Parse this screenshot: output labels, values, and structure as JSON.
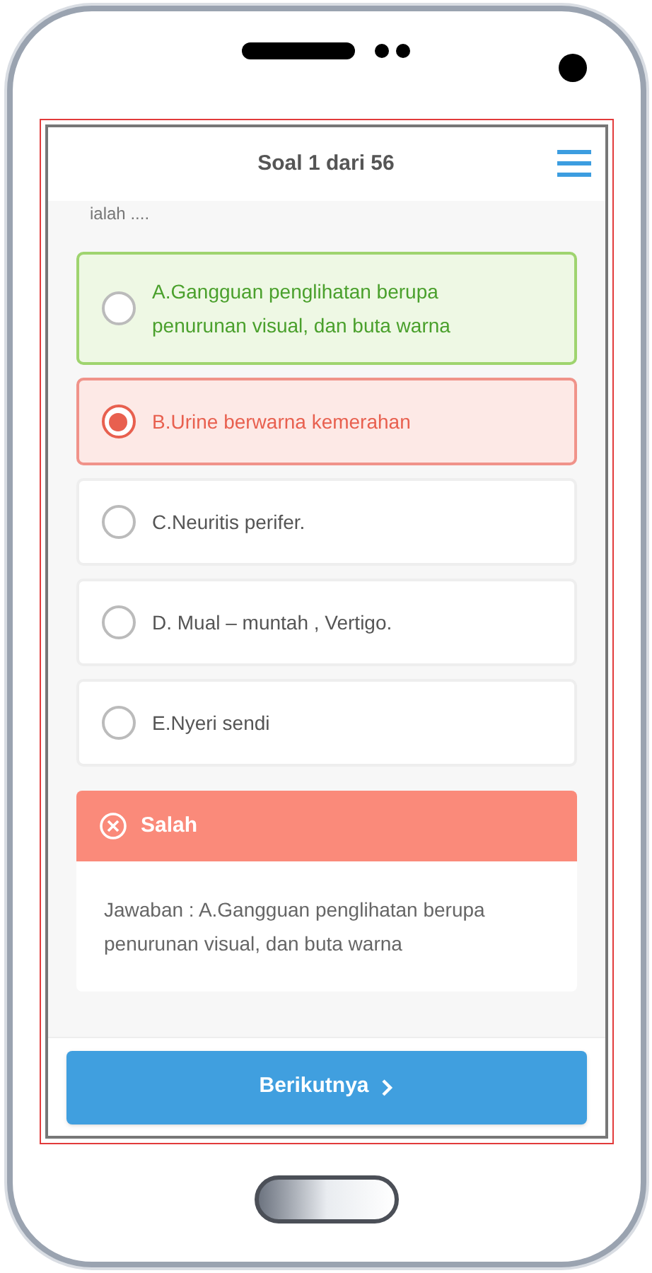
{
  "header": {
    "title": "Soal 1 dari 56"
  },
  "question_tail": "ialah ....",
  "options": [
    {
      "label": "A.Gangguan penglihatan berupa penurunan visual, dan buta warna",
      "selected": false,
      "kind": "correct"
    },
    {
      "label": "B.Urine berwarna kemerahan",
      "selected": true,
      "kind": "wrong"
    },
    {
      "label": "C.Neuritis perifer.",
      "selected": false,
      "kind": "plain"
    },
    {
      "label": "D. Mual – muntah , Vertigo.",
      "selected": false,
      "kind": "plain"
    },
    {
      "label": "E.Nyeri sendi",
      "selected": false,
      "kind": "plain"
    }
  ],
  "feedback": {
    "kind": "wrong",
    "title": "Salah",
    "answer": "Jawaban : A.Gangguan penglihatan berupa penurunan visual, dan buta warna"
  },
  "next_button": {
    "label": "Berikutnya"
  }
}
